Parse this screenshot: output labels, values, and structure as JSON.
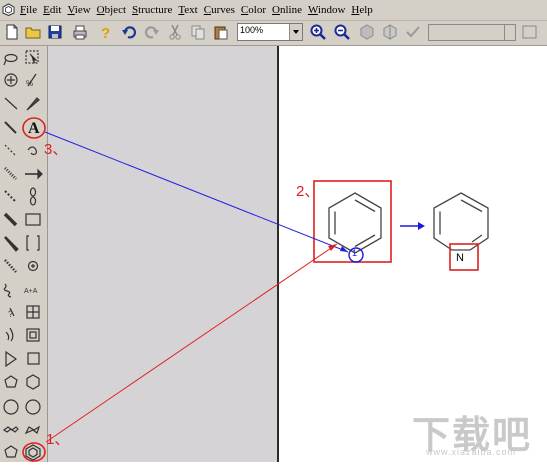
{
  "menu": {
    "items": [
      "File",
      "Edit",
      "View",
      "Object",
      "Structure",
      "Text",
      "Curves",
      "Color",
      "Online",
      "Window",
      "Help"
    ]
  },
  "toolbar": {
    "icons": [
      "new-document-icon",
      "open-folder-icon",
      "save-icon",
      "print-icon",
      "help-icon",
      "undo-icon",
      "redo-icon",
      "cut-icon",
      "copy-icon",
      "paste-icon"
    ],
    "zoom_value": "100%"
  },
  "palette": {
    "text_tool_label": "A",
    "rows": [
      [
        "lasso-icon",
        "marquee-select-icon"
      ],
      [
        "structure-perspective-icon",
        "eraser-icon"
      ],
      [
        "single-bond-icon",
        "wedge-bond-icon"
      ],
      [
        "pen-icon",
        "text-tool-icon"
      ],
      [
        "dashed-bond-icon",
        "chain-icon"
      ],
      [
        "hashed-bond-icon",
        "arrow-tool-icon"
      ],
      [
        "bold-dashed-bond-icon",
        "orbital-icon"
      ],
      [
        "bold-bond-icon",
        "rectangle-icon"
      ],
      [
        "wedge-bold-icon",
        "bracket-icon"
      ],
      [
        "hashed-wedge-icon",
        "charge-icon"
      ],
      [
        "wavy-bond-icon",
        "attach-icon"
      ],
      [
        "query-icon",
        "table-icon"
      ],
      [
        "ring-3-icon",
        "template-icon"
      ],
      [
        "triangle-icon",
        "square-icon"
      ],
      [
        "pentagon-icon",
        "hexagon-icon"
      ],
      [
        "heptagon-icon",
        "octagon-icon"
      ],
      [
        "chair-left-icon",
        "chair-right-icon"
      ],
      [
        "cyclopentadiene-icon",
        "benzene-ring-icon"
      ]
    ]
  },
  "annotations": {
    "step1": "1、",
    "step2": "2、",
    "step3": "3、"
  },
  "molecule": {
    "atom_label_small": "1",
    "nitrogen_label": "N"
  },
  "colors": {
    "chrome": "#d4d0c8",
    "workspace": "#d6d3d6",
    "annotation_red": "#e02020",
    "arrow_blue": "#1a1adf"
  },
  "watermark": {
    "main": "下载吧",
    "sub": "www.xiazaiba.com"
  }
}
